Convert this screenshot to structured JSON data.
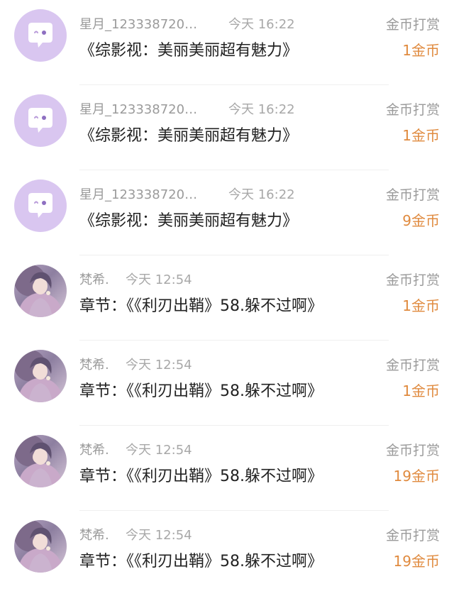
{
  "colors": {
    "reward_amount": "#e08a3e",
    "meta_text": "#9b9b9b",
    "content_text": "#222222",
    "bot_avatar_bg": "#d9c6f0"
  },
  "items": [
    {
      "avatar": "bot-face-icon",
      "name": "星月_123338720…",
      "time": "今天 16:22",
      "content": "《综影视：美丽美丽超有魅力》",
      "reward_label": "金币打赏",
      "reward_amount": "1金币"
    },
    {
      "avatar": "bot-face-icon",
      "name": "星月_123338720…",
      "time": "今天 16:22",
      "content": "《综影视：美丽美丽超有魅力》",
      "reward_label": "金币打赏",
      "reward_amount": "1金币"
    },
    {
      "avatar": "bot-face-icon",
      "name": "星月_123338720…",
      "time": "今天 16:22",
      "content": "《综影视：美丽美丽超有魅力》",
      "reward_label": "金币打赏",
      "reward_amount": "9金币"
    },
    {
      "avatar": "user-photo",
      "name": "梵希.",
      "time": "今天 12:54",
      "content": "章节：《《利刃出鞘》58.躲不过啊》",
      "reward_label": "金币打赏",
      "reward_amount": "1金币"
    },
    {
      "avatar": "user-photo",
      "name": "梵希.",
      "time": "今天 12:54",
      "content": "章节：《《利刃出鞘》58.躲不过啊》",
      "reward_label": "金币打赏",
      "reward_amount": "1金币"
    },
    {
      "avatar": "user-photo",
      "name": "梵希.",
      "time": "今天 12:54",
      "content": "章节：《《利刃出鞘》58.躲不过啊》",
      "reward_label": "金币打赏",
      "reward_amount": "19金币"
    },
    {
      "avatar": "user-photo",
      "name": "梵希.",
      "time": "今天 12:54",
      "content": "章节：《《利刃出鞘》58.躲不过啊》",
      "reward_label": "金币打赏",
      "reward_amount": "19金币"
    }
  ]
}
